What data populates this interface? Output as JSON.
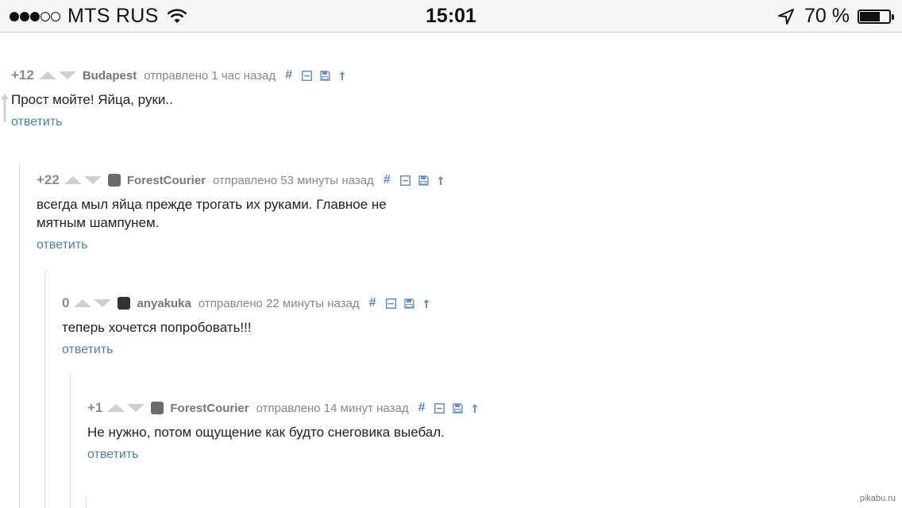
{
  "status_bar": {
    "signal_dots": [
      true,
      true,
      true,
      false,
      false
    ],
    "carrier": "MTS RUS",
    "time": "15:01",
    "battery_percent_text": "70 %",
    "battery_level": 0.7
  },
  "comments": [
    {
      "score": "+12",
      "author": "Budapest",
      "has_avatar": false,
      "sent": "отправлено 1 час назад",
      "text": "Прост мойте! Яйца, руки..",
      "reply": "ответить"
    },
    {
      "score": "+22",
      "author": "ForestCourier",
      "has_avatar": true,
      "sent": "отправлено 53 минуты назад",
      "text": "всегда мыл яйца прежде трогать их руками. Главное не мятным шампунем.",
      "reply": "ответить"
    },
    {
      "score": "0",
      "author": "anyakuka",
      "has_avatar": true,
      "sent": "отправлено 22 минуты назад",
      "text": "теперь хочется попробовать!!!",
      "reply": "ответить"
    },
    {
      "score": "+1",
      "author": "ForestCourier",
      "has_avatar": true,
      "sent": "отправлено 14 минут назад",
      "text": "Не нужно, потом ощущение как будто снеговика выебал.",
      "reply": "ответить"
    }
  ],
  "action_icons": [
    "hash-icon",
    "collapse-icon",
    "save-icon",
    "arrow-up-icon"
  ],
  "hash_symbol": "#",
  "watermark": "pikabu.ru",
  "colors": {
    "link": "#4f7fa9",
    "action": "#6a8fc0",
    "meta": "#888888"
  }
}
